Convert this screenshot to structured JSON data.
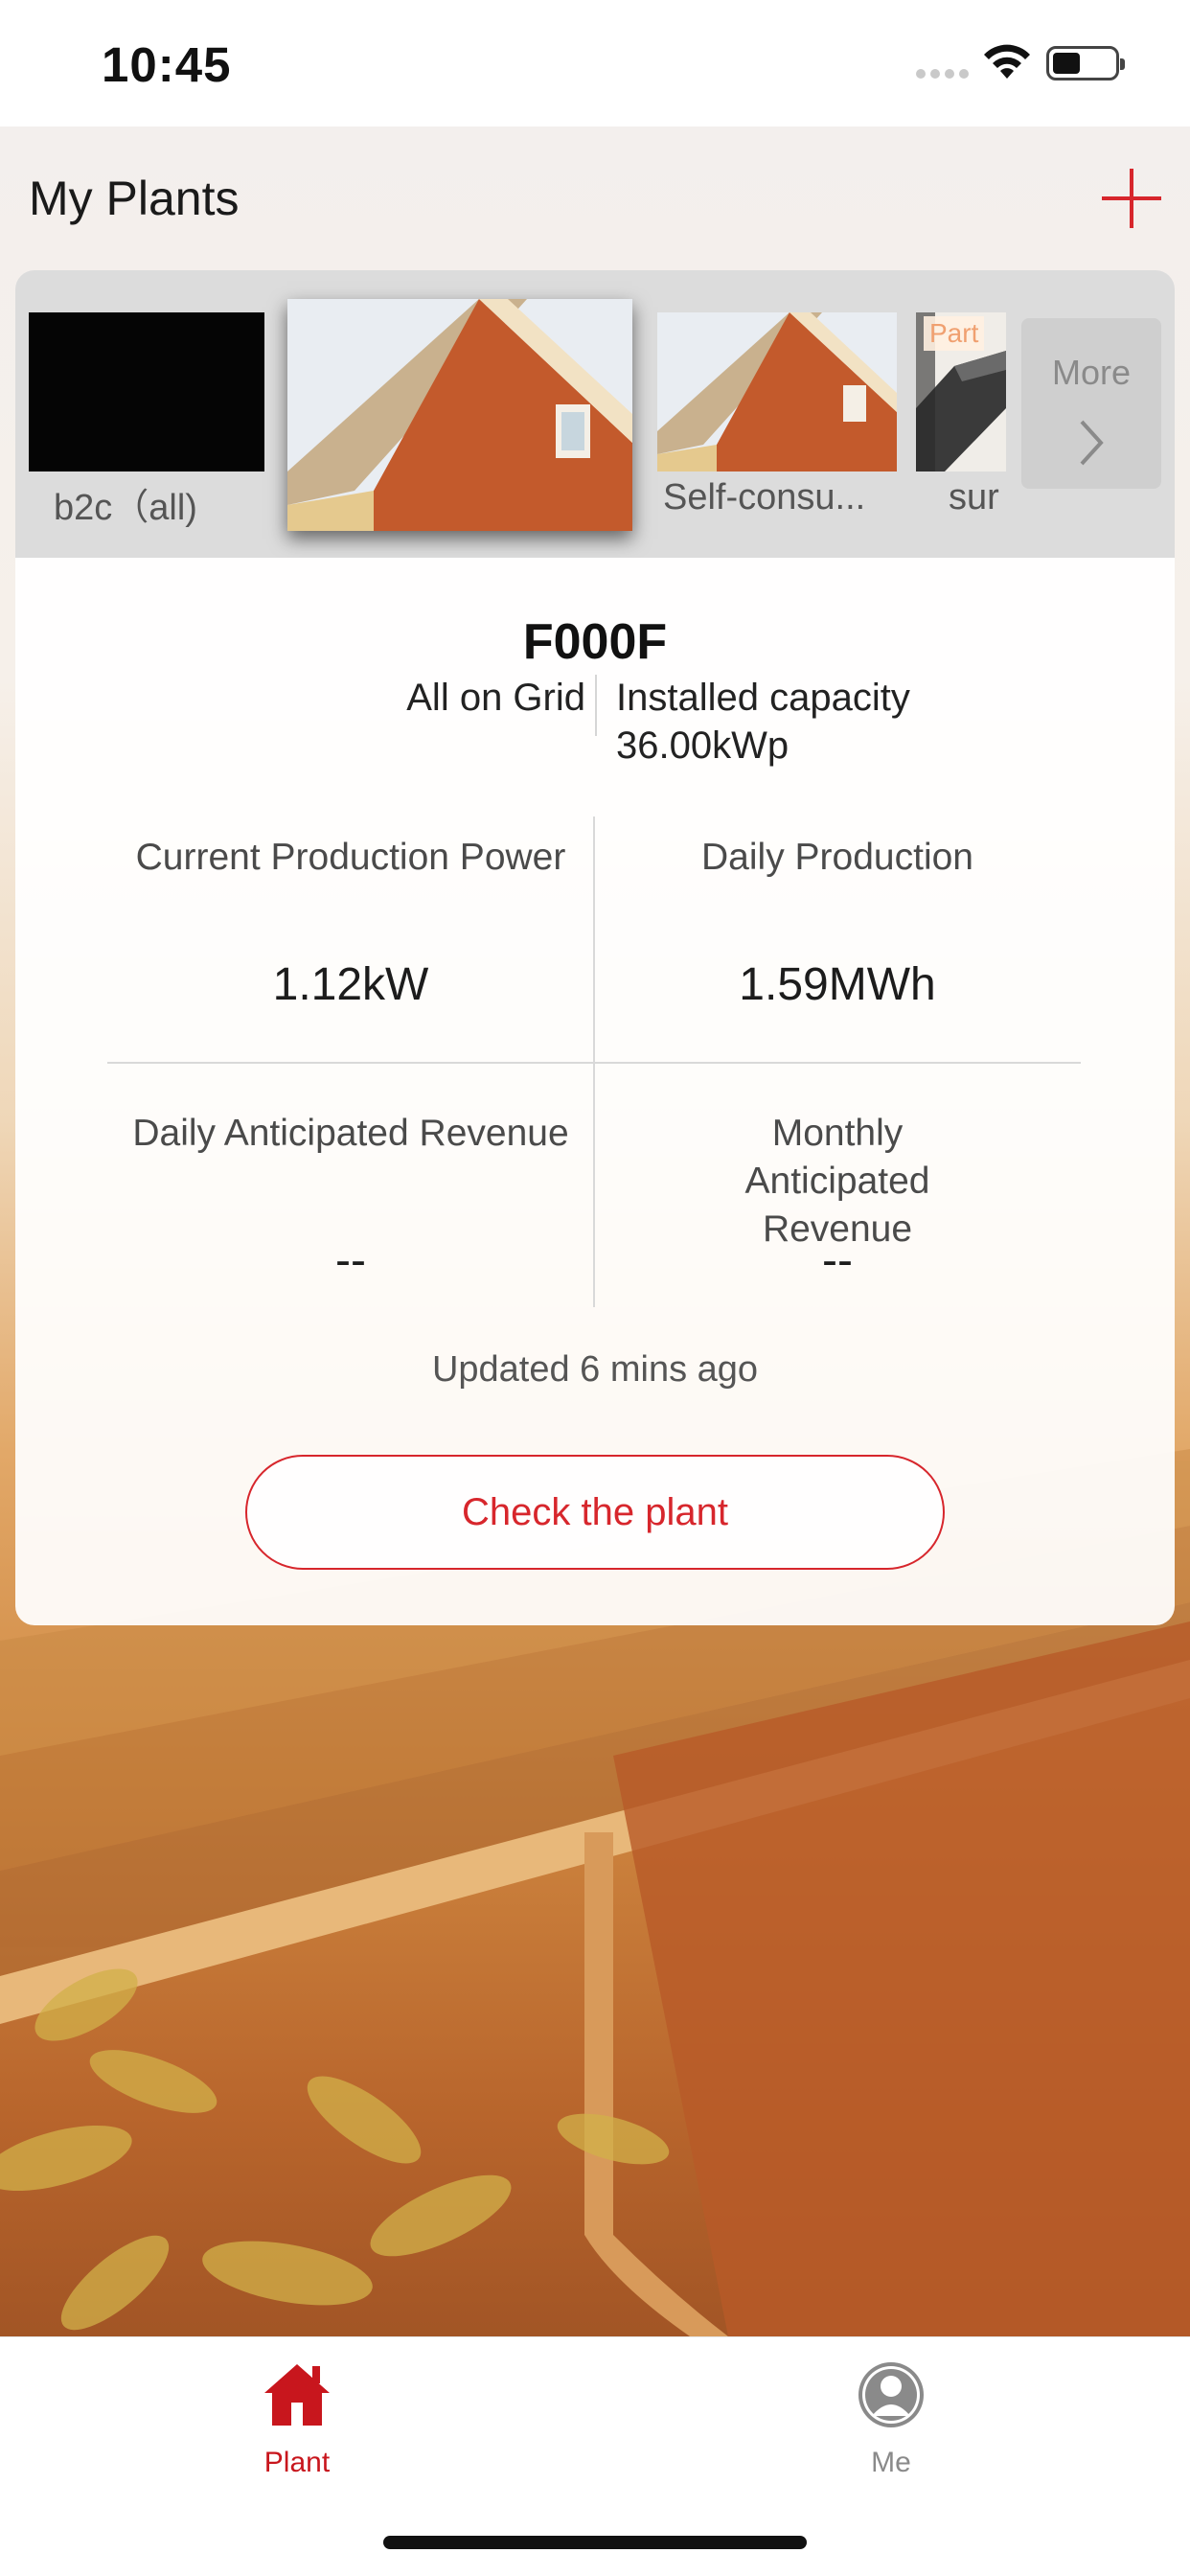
{
  "status_bar": {
    "time": "10:45"
  },
  "header": {
    "title": "My Plants",
    "add_icon": "plus-icon"
  },
  "carousel": {
    "items": [
      {
        "label": "b2c（all)",
        "image": "black-placeholder"
      },
      {
        "label": "",
        "image": "house-roof-photo",
        "selected": true
      },
      {
        "label": "Self-consu...",
        "image": "house-roof-photo"
      },
      {
        "label": "sur",
        "image": "solar-panel-photo",
        "tag": "Part"
      }
    ],
    "more_label": "More"
  },
  "plant": {
    "name": "F000F",
    "grid_type": "All on Grid",
    "capacity_label": "Installed capacity",
    "capacity_value": "36.00kWp"
  },
  "stats": {
    "current_power_label": "Current Production Power",
    "current_power_value": "1.12kW",
    "daily_production_label": "Daily Production",
    "daily_production_value": "1.59MWh",
    "daily_revenue_label": "Daily Anticipated Revenue",
    "daily_revenue_value": "--",
    "monthly_revenue_label": "Monthly Anticipated Revenue",
    "monthly_revenue_value": "--"
  },
  "updated_text": "Updated 6 mins ago",
  "check_button_label": "Check the plant",
  "tabs": [
    {
      "label": "Plant",
      "icon": "home-icon",
      "active": true
    },
    {
      "label": "Me",
      "icon": "person-icon",
      "active": false
    }
  ],
  "colors": {
    "accent": "#d7262c",
    "tab_active": "#c8161d"
  }
}
